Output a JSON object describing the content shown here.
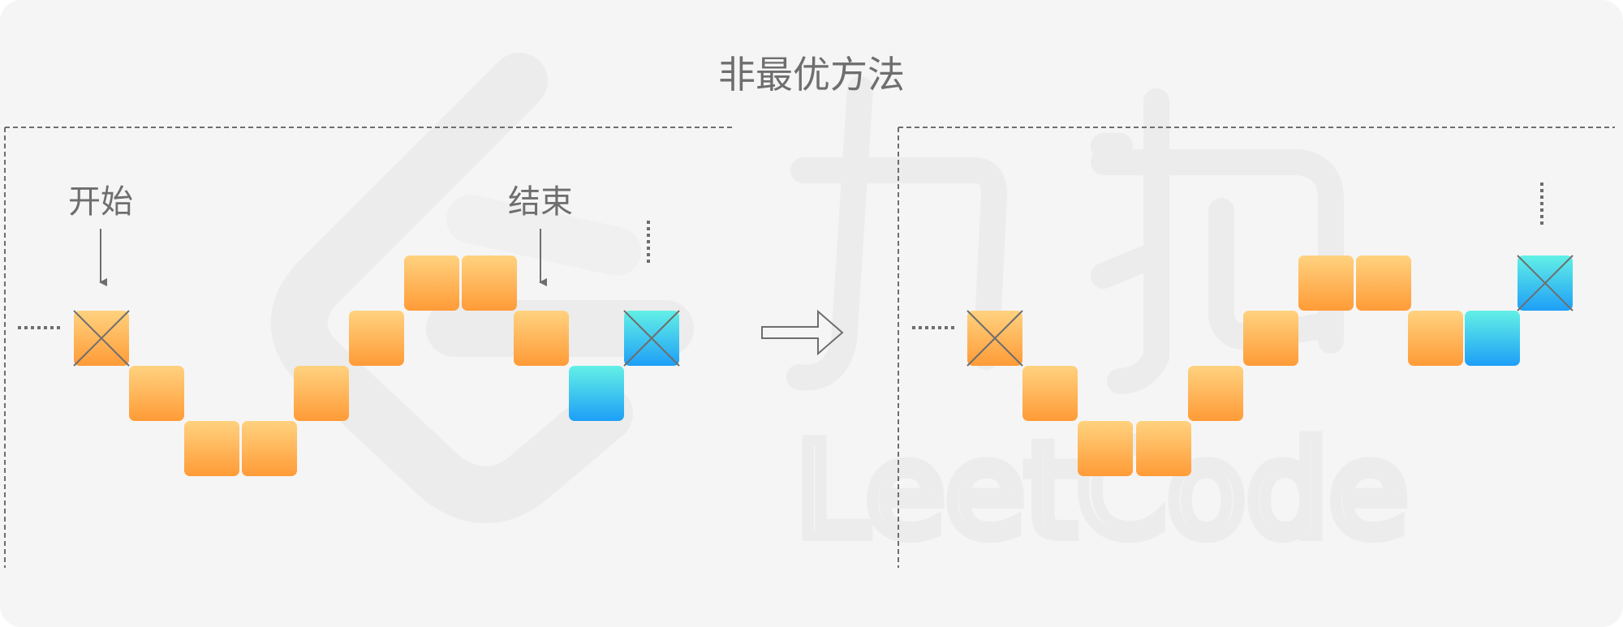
{
  "title": "非最优方法",
  "left_panel": {
    "start_label": "开始",
    "end_label": "结束"
  },
  "colors": {
    "background": "#f5f5f5",
    "orange_top": "#ffd27f",
    "orange_bottom": "#ff9b37",
    "blue_top": "#63f0e6",
    "blue_bottom": "#1e9ff7",
    "line": "#6e6e6e",
    "watermark": "#ececec"
  },
  "watermark": {
    "text": "LeetCode",
    "logo": "leetcode-logo",
    "chinese_mark": "力扣"
  }
}
